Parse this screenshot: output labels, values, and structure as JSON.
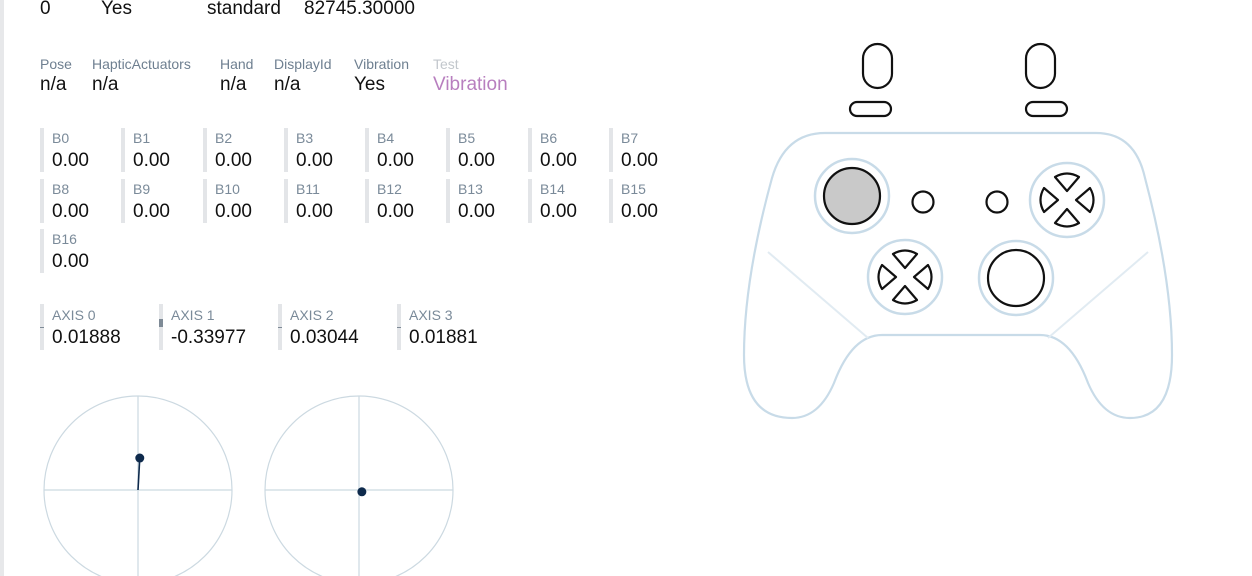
{
  "top_row": [
    "0",
    "Yes",
    "standard",
    "82745.30000"
  ],
  "info": [
    {
      "label": "Pose",
      "value": "n/a"
    },
    {
      "label": "HapticActuators",
      "value": "n/a"
    },
    {
      "label": "Hand",
      "value": "n/a"
    },
    {
      "label": "DisplayId",
      "value": "n/a"
    },
    {
      "label": "Vibration",
      "value": "Yes"
    },
    {
      "label": "Test",
      "value": "Vibration"
    }
  ],
  "buttons": [
    {
      "label": "B0",
      "value": "0.00"
    },
    {
      "label": "B1",
      "value": "0.00"
    },
    {
      "label": "B2",
      "value": "0.00"
    },
    {
      "label": "B3",
      "value": "0.00"
    },
    {
      "label": "B4",
      "value": "0.00"
    },
    {
      "label": "B5",
      "value": "0.00"
    },
    {
      "label": "B6",
      "value": "0.00"
    },
    {
      "label": "B7",
      "value": "0.00"
    },
    {
      "label": "B8",
      "value": "0.00"
    },
    {
      "label": "B9",
      "value": "0.00"
    },
    {
      "label": "B10",
      "value": "0.00"
    },
    {
      "label": "B11",
      "value": "0.00"
    },
    {
      "label": "B12",
      "value": "0.00"
    },
    {
      "label": "B13",
      "value": "0.00"
    },
    {
      "label": "B14",
      "value": "0.00"
    },
    {
      "label": "B15",
      "value": "0.00"
    },
    {
      "label": "B16",
      "value": "0.00"
    }
  ],
  "axes": [
    {
      "label": "AXIS 0",
      "value": "0.01888"
    },
    {
      "label": "AXIS 1",
      "value": "-0.33977"
    },
    {
      "label": "AXIS 2",
      "value": "0.03044"
    },
    {
      "label": "AXIS 3",
      "value": "0.01881"
    }
  ],
  "colors": {
    "stick_dot": "#0e2a4c",
    "outline": "#c8dbe8",
    "pressed_fill": "#c9c9c9",
    "test_link": "#b87fbf"
  },
  "icons": [
    "gamepad-icon",
    "dpad-icon",
    "face-buttons-icon"
  ]
}
